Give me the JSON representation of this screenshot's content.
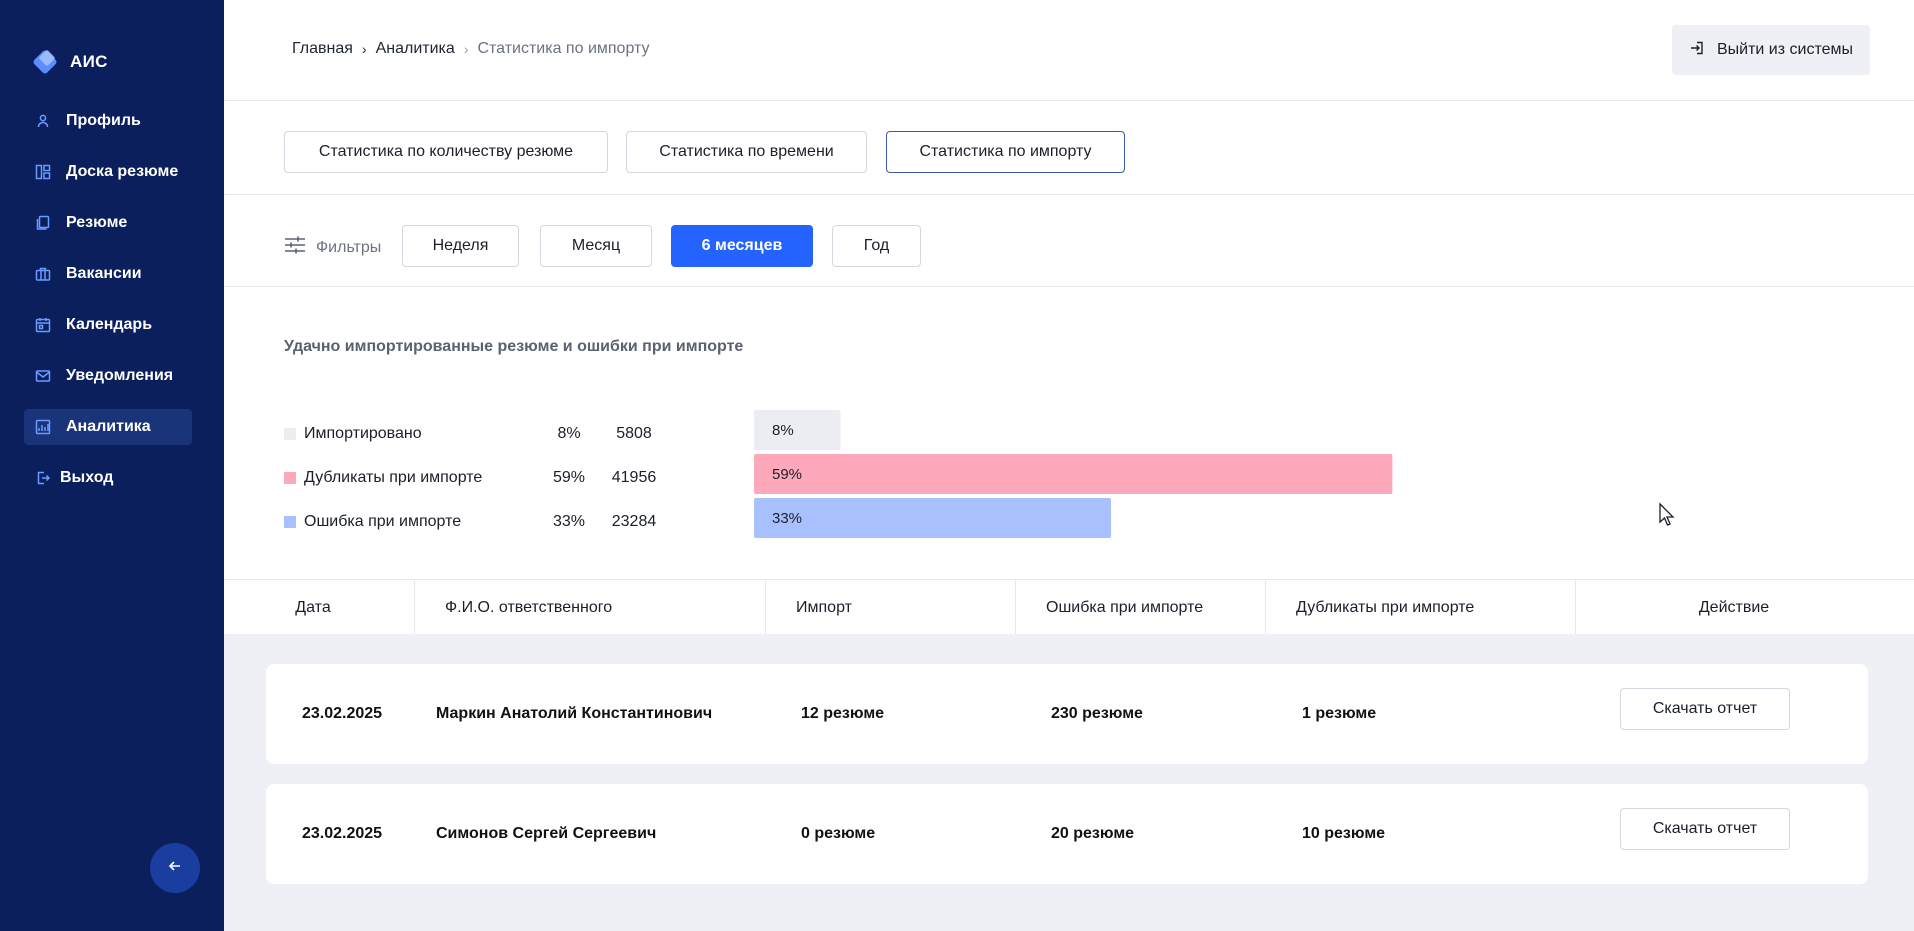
{
  "app": {
    "title": "АИС"
  },
  "sidebar": {
    "items": [
      {
        "label": "Профиль",
        "icon": "user-icon"
      },
      {
        "label": "Доска резюме",
        "icon": "board-icon"
      },
      {
        "label": "Резюме",
        "icon": "documents-icon"
      },
      {
        "label": "Вакансии",
        "icon": "briefcase-icon"
      },
      {
        "label": "Календарь",
        "icon": "calendar-icon"
      },
      {
        "label": "Уведомления",
        "icon": "mail-icon"
      },
      {
        "label": "Аналитика",
        "icon": "chart-icon",
        "active": true
      },
      {
        "label": "Выход",
        "icon": "logout-icon"
      }
    ],
    "collapse_icon": "arrow-left-icon"
  },
  "header": {
    "breadcrumb": [
      "Главная",
      "Аналитика",
      "Статистика по импорту"
    ],
    "logout_label": "Выйти из системы"
  },
  "tabs": [
    {
      "label": "Статистика по количеству резюме"
    },
    {
      "label": "Статистика по времени"
    },
    {
      "label": "Статистика по импорту",
      "active": true
    }
  ],
  "filters": {
    "label": "Фильтры",
    "periods": [
      "Неделя",
      "Месяц",
      "6 месяцев",
      "Год"
    ],
    "selected": "6 месяцев"
  },
  "chart_data": {
    "type": "bar",
    "orientation": "horizontal",
    "title": "Удачно импортированные резюме и ошибки при импорте",
    "categories": [
      "Импортировано",
      "Дубликаты при импорте",
      "Ошибка при импорте"
    ],
    "percent": [
      8,
      59,
      33
    ],
    "values": [
      5808,
      41956,
      23284
    ],
    "percent_labels": [
      "8%",
      "59%",
      "33%"
    ],
    "colors": [
      "#ecedf2",
      "#fda8bb",
      "#a9c0ff"
    ],
    "xlim": [
      0,
      100
    ],
    "grid": false,
    "legend": "left"
  },
  "table": {
    "columns": [
      "Дата",
      "Ф.И.О. ответственного",
      "Импорт",
      "Ошибка при импорте",
      "Дубликаты при импорте",
      "Действие"
    ],
    "rows": [
      {
        "date": "23.02.2025",
        "name": "Маркин Анатолий Константинович",
        "import": "12 резюме",
        "errors": "230 резюме",
        "duplicates": "1 резюме",
        "action": "Скачать отчет"
      },
      {
        "date": "23.02.2025",
        "name": "Симонов Сергей Сергеевич",
        "import": "0 резюме",
        "errors": "20 резюме",
        "duplicates": "10 резюме",
        "action": "Скачать отчет"
      }
    ]
  },
  "colors": {
    "sidebar_bg": "#0b1f5c",
    "accent": "#2563ff",
    "page_bg": "#eef0f5"
  }
}
